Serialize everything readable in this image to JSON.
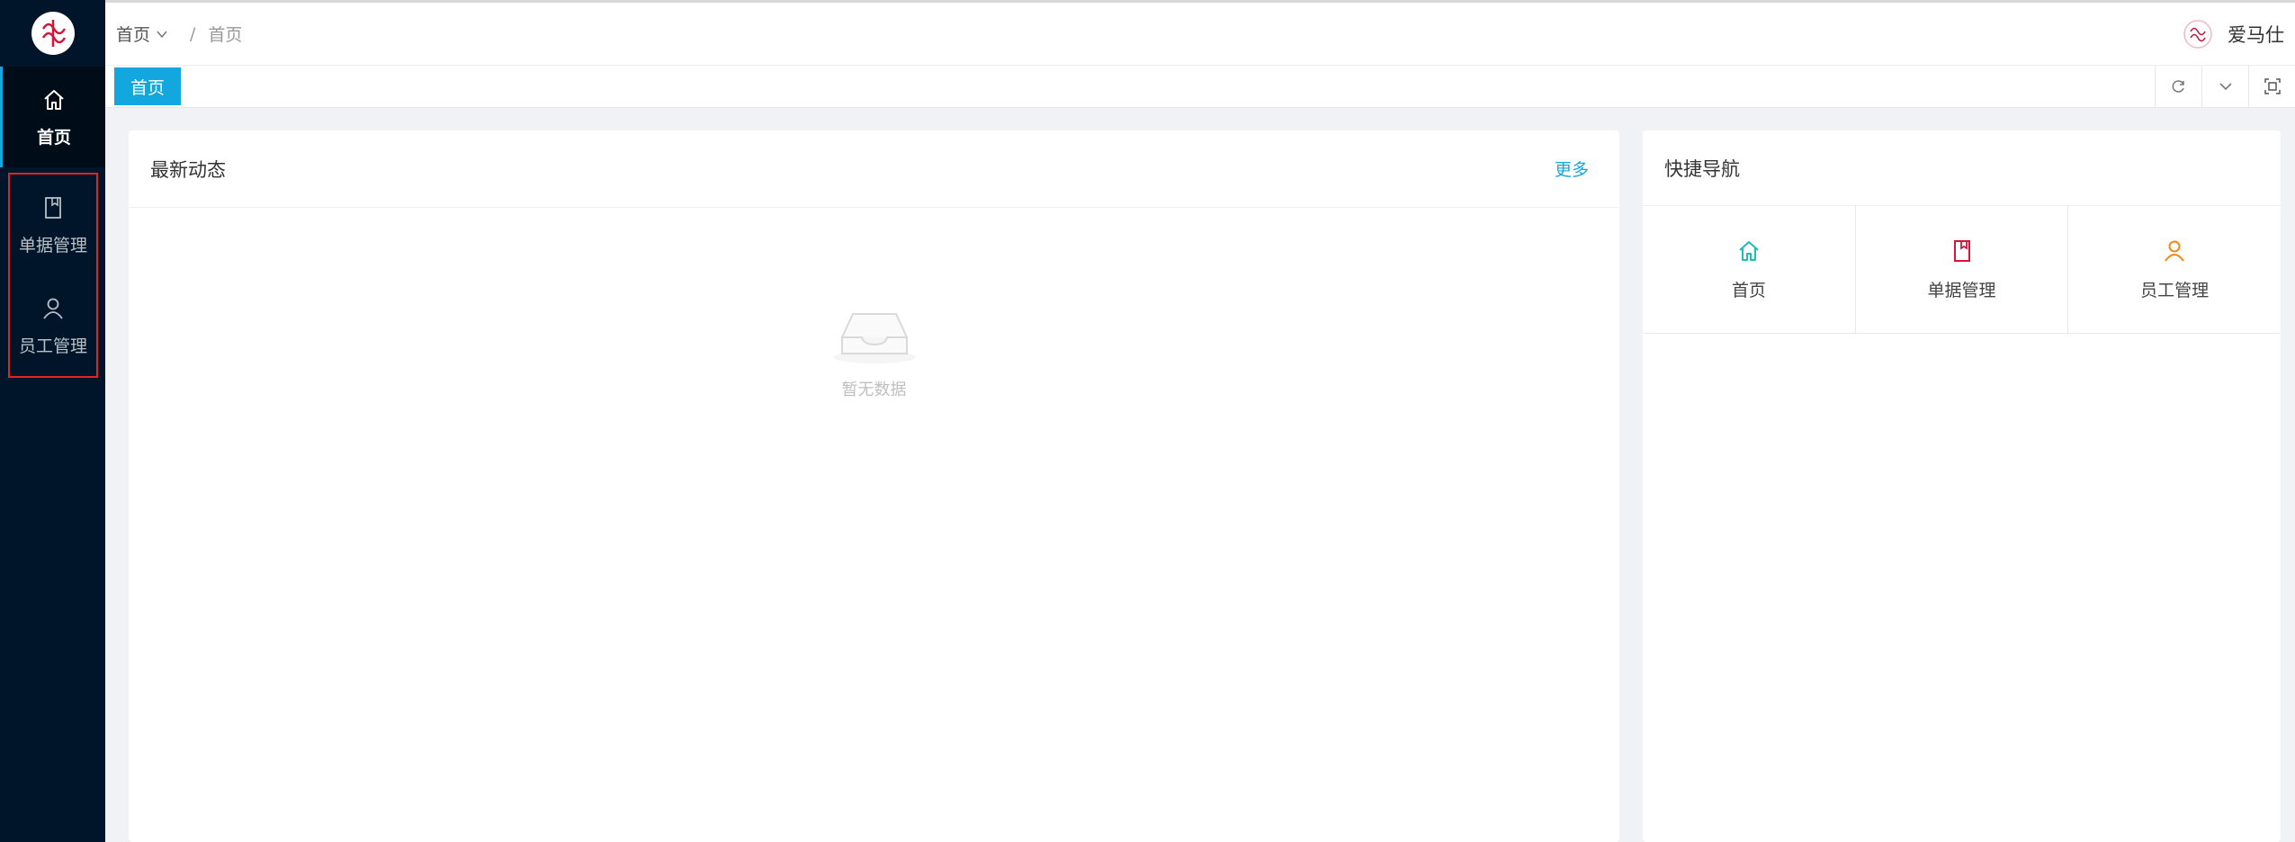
{
  "sidebar": {
    "items": [
      {
        "label": "首页",
        "icon": "home-icon"
      },
      {
        "label": "单据管理",
        "icon": "document-icon"
      },
      {
        "label": "员工管理",
        "icon": "user-icon"
      }
    ]
  },
  "header": {
    "breadcrumb": {
      "root": "首页",
      "separator": "/",
      "current": "首页"
    },
    "username": "爱马仕"
  },
  "tabs": [
    {
      "label": "首页"
    }
  ],
  "news": {
    "title": "最新动态",
    "more": "更多",
    "empty": "暂无数据"
  },
  "quick_nav": {
    "title": "快捷导航",
    "items": [
      {
        "label": "首页",
        "icon": "home-icon",
        "color": "#19c0b4"
      },
      {
        "label": "单据管理",
        "icon": "document-icon",
        "color": "#d4153a"
      },
      {
        "label": "员工管理",
        "icon": "user-icon",
        "color": "#f08a13"
      }
    ]
  },
  "colors": {
    "sidebar_bg": "#001529",
    "accent": "#12a8df",
    "highlight_box": "#e02424"
  }
}
